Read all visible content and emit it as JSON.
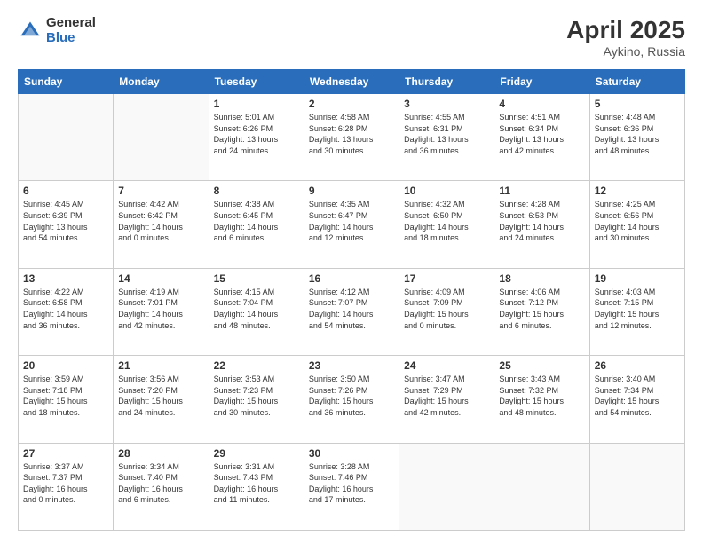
{
  "logo": {
    "general": "General",
    "blue": "Blue"
  },
  "title": {
    "month": "April 2025",
    "location": "Aykino, Russia"
  },
  "headers": [
    "Sunday",
    "Monday",
    "Tuesday",
    "Wednesday",
    "Thursday",
    "Friday",
    "Saturday"
  ],
  "weeks": [
    [
      {
        "day": "",
        "info": ""
      },
      {
        "day": "",
        "info": ""
      },
      {
        "day": "1",
        "info": "Sunrise: 5:01 AM\nSunset: 6:26 PM\nDaylight: 13 hours\nand 24 minutes."
      },
      {
        "day": "2",
        "info": "Sunrise: 4:58 AM\nSunset: 6:28 PM\nDaylight: 13 hours\nand 30 minutes."
      },
      {
        "day": "3",
        "info": "Sunrise: 4:55 AM\nSunset: 6:31 PM\nDaylight: 13 hours\nand 36 minutes."
      },
      {
        "day": "4",
        "info": "Sunrise: 4:51 AM\nSunset: 6:34 PM\nDaylight: 13 hours\nand 42 minutes."
      },
      {
        "day": "5",
        "info": "Sunrise: 4:48 AM\nSunset: 6:36 PM\nDaylight: 13 hours\nand 48 minutes."
      }
    ],
    [
      {
        "day": "6",
        "info": "Sunrise: 4:45 AM\nSunset: 6:39 PM\nDaylight: 13 hours\nand 54 minutes."
      },
      {
        "day": "7",
        "info": "Sunrise: 4:42 AM\nSunset: 6:42 PM\nDaylight: 14 hours\nand 0 minutes."
      },
      {
        "day": "8",
        "info": "Sunrise: 4:38 AM\nSunset: 6:45 PM\nDaylight: 14 hours\nand 6 minutes."
      },
      {
        "day": "9",
        "info": "Sunrise: 4:35 AM\nSunset: 6:47 PM\nDaylight: 14 hours\nand 12 minutes."
      },
      {
        "day": "10",
        "info": "Sunrise: 4:32 AM\nSunset: 6:50 PM\nDaylight: 14 hours\nand 18 minutes."
      },
      {
        "day": "11",
        "info": "Sunrise: 4:28 AM\nSunset: 6:53 PM\nDaylight: 14 hours\nand 24 minutes."
      },
      {
        "day": "12",
        "info": "Sunrise: 4:25 AM\nSunset: 6:56 PM\nDaylight: 14 hours\nand 30 minutes."
      }
    ],
    [
      {
        "day": "13",
        "info": "Sunrise: 4:22 AM\nSunset: 6:58 PM\nDaylight: 14 hours\nand 36 minutes."
      },
      {
        "day": "14",
        "info": "Sunrise: 4:19 AM\nSunset: 7:01 PM\nDaylight: 14 hours\nand 42 minutes."
      },
      {
        "day": "15",
        "info": "Sunrise: 4:15 AM\nSunset: 7:04 PM\nDaylight: 14 hours\nand 48 minutes."
      },
      {
        "day": "16",
        "info": "Sunrise: 4:12 AM\nSunset: 7:07 PM\nDaylight: 14 hours\nand 54 minutes."
      },
      {
        "day": "17",
        "info": "Sunrise: 4:09 AM\nSunset: 7:09 PM\nDaylight: 15 hours\nand 0 minutes."
      },
      {
        "day": "18",
        "info": "Sunrise: 4:06 AM\nSunset: 7:12 PM\nDaylight: 15 hours\nand 6 minutes."
      },
      {
        "day": "19",
        "info": "Sunrise: 4:03 AM\nSunset: 7:15 PM\nDaylight: 15 hours\nand 12 minutes."
      }
    ],
    [
      {
        "day": "20",
        "info": "Sunrise: 3:59 AM\nSunset: 7:18 PM\nDaylight: 15 hours\nand 18 minutes."
      },
      {
        "day": "21",
        "info": "Sunrise: 3:56 AM\nSunset: 7:20 PM\nDaylight: 15 hours\nand 24 minutes."
      },
      {
        "day": "22",
        "info": "Sunrise: 3:53 AM\nSunset: 7:23 PM\nDaylight: 15 hours\nand 30 minutes."
      },
      {
        "day": "23",
        "info": "Sunrise: 3:50 AM\nSunset: 7:26 PM\nDaylight: 15 hours\nand 36 minutes."
      },
      {
        "day": "24",
        "info": "Sunrise: 3:47 AM\nSunset: 7:29 PM\nDaylight: 15 hours\nand 42 minutes."
      },
      {
        "day": "25",
        "info": "Sunrise: 3:43 AM\nSunset: 7:32 PM\nDaylight: 15 hours\nand 48 minutes."
      },
      {
        "day": "26",
        "info": "Sunrise: 3:40 AM\nSunset: 7:34 PM\nDaylight: 15 hours\nand 54 minutes."
      }
    ],
    [
      {
        "day": "27",
        "info": "Sunrise: 3:37 AM\nSunset: 7:37 PM\nDaylight: 16 hours\nand 0 minutes."
      },
      {
        "day": "28",
        "info": "Sunrise: 3:34 AM\nSunset: 7:40 PM\nDaylight: 16 hours\nand 6 minutes."
      },
      {
        "day": "29",
        "info": "Sunrise: 3:31 AM\nSunset: 7:43 PM\nDaylight: 16 hours\nand 11 minutes."
      },
      {
        "day": "30",
        "info": "Sunrise: 3:28 AM\nSunset: 7:46 PM\nDaylight: 16 hours\nand 17 minutes."
      },
      {
        "day": "",
        "info": ""
      },
      {
        "day": "",
        "info": ""
      },
      {
        "day": "",
        "info": ""
      }
    ]
  ]
}
